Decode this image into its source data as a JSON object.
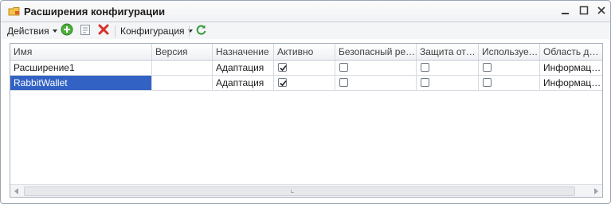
{
  "window": {
    "title": "Расширения конфигурации",
    "icon": "folder-with-plug-icon"
  },
  "toolbar": {
    "actions_label": "Действия",
    "config_label": "Конфигурация",
    "icons": [
      "add-circle-icon",
      "properties-icon",
      "delete-x-icon",
      "refresh-icon"
    ]
  },
  "table": {
    "columns": [
      {
        "label": "Имя"
      },
      {
        "label": "Версия"
      },
      {
        "label": "Назначение"
      },
      {
        "label": "Активно"
      },
      {
        "label": "Безопасный реж..."
      },
      {
        "label": "Защита от о..."
      },
      {
        "label": "Использует..."
      },
      {
        "label": "Область де..."
      }
    ],
    "rows": [
      {
        "name": "Расширение1",
        "version": "",
        "purpose": "Адаптация",
        "active": true,
        "safe_mode": false,
        "protection": false,
        "uses": false,
        "scope": "Информаци...",
        "selected": false
      },
      {
        "name": "RabbitWallet",
        "version": "",
        "purpose": "Адаптация",
        "active": true,
        "safe_mode": false,
        "protection": false,
        "uses": false,
        "scope": "Информаци...",
        "selected": true
      }
    ]
  },
  "colors": {
    "selection": "#3262c4",
    "add_icon": "#4caf3c",
    "delete_icon": "#d8322a",
    "refresh_icon": "#2f9a36"
  }
}
